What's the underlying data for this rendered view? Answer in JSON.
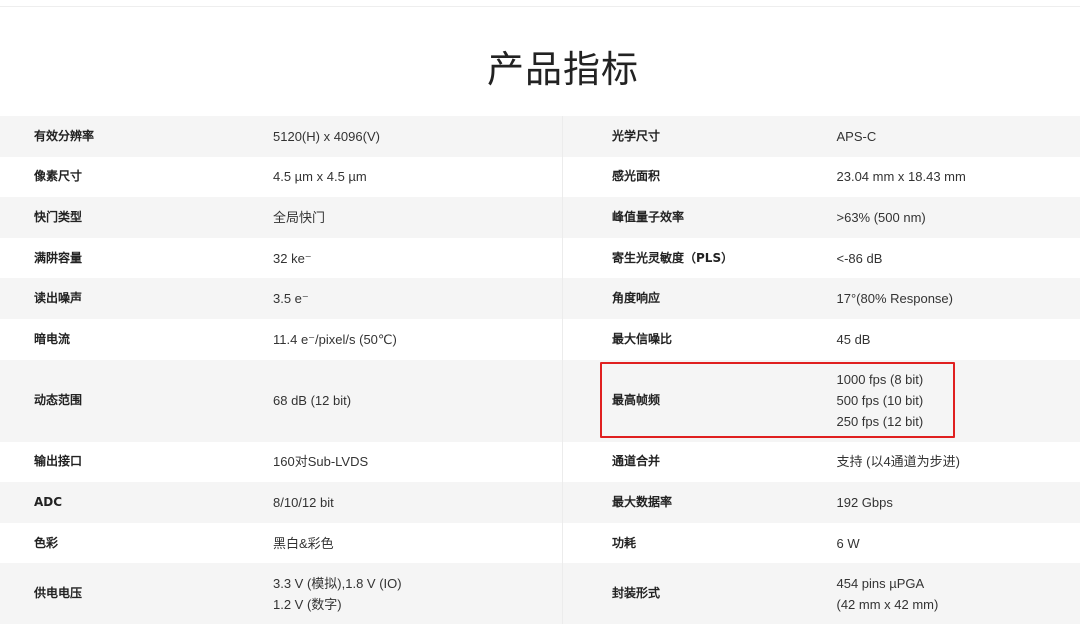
{
  "page": {
    "title": "产品指标"
  },
  "table": {
    "rows": [
      {
        "k1": "有效分辨率",
        "v1": [
          "5120(H) x 4096(V)"
        ],
        "k2": "光学尺寸",
        "v2": [
          "APS-C"
        ]
      },
      {
        "k1": "像素尺寸",
        "v1": [
          "4.5 µm x 4.5 µm"
        ],
        "k2": "感光面积",
        "v2": [
          "23.04 mm x 18.43 mm"
        ]
      },
      {
        "k1": "快门类型",
        "v1": [
          "全局快门"
        ],
        "k2": "峰值量子效率",
        "v2": [
          ">63% (500 nm)"
        ]
      },
      {
        "k1": "满阱容量",
        "v1": [
          "32 ke⁻"
        ],
        "k2": "寄生光灵敏度（PLS）",
        "v2": [
          "<-86 dB"
        ]
      },
      {
        "k1": "读出噪声",
        "v1": [
          "3.5 e⁻"
        ],
        "k2": "角度响应",
        "v2": [
          "17°(80% Response)"
        ]
      },
      {
        "k1": "暗电流",
        "v1": [
          "11.4 e⁻/pixel/s (50℃)"
        ],
        "k2": "最大信噪比",
        "v2": [
          "45 dB"
        ]
      },
      {
        "k1": "动态范围",
        "v1": [
          "68 dB (12 bit)"
        ],
        "k2": "最高帧频",
        "v2": [
          "1000 fps (8 bit)",
          "500 fps (10 bit)",
          "250 fps (12 bit)"
        ]
      },
      {
        "k1": "输出接口",
        "v1": [
          "160对Sub-LVDS"
        ],
        "k2": "通道合并",
        "v2": [
          "支持 (以4通道为步进)"
        ]
      },
      {
        "k1": "ADC",
        "v1": [
          "8/10/12 bit"
        ],
        "k2": "最大数据率",
        "v2": [
          "192 Gbps"
        ]
      },
      {
        "k1": "色彩",
        "v1": [
          "黑白&彩色"
        ],
        "k2": "功耗",
        "v2": [
          "6 W"
        ]
      },
      {
        "k1": "供电电压",
        "v1": [
          "3.3 V (模拟),1.8 V (IO)",
          "1.2 V (数字)"
        ],
        "k2": "封装形式",
        "v2": [
          "454 pins µPGA",
          "(42 mm x 42 mm)"
        ]
      }
    ]
  },
  "colors": {
    "highlight": "#e02020",
    "row_shade": "#f5f5f5"
  }
}
